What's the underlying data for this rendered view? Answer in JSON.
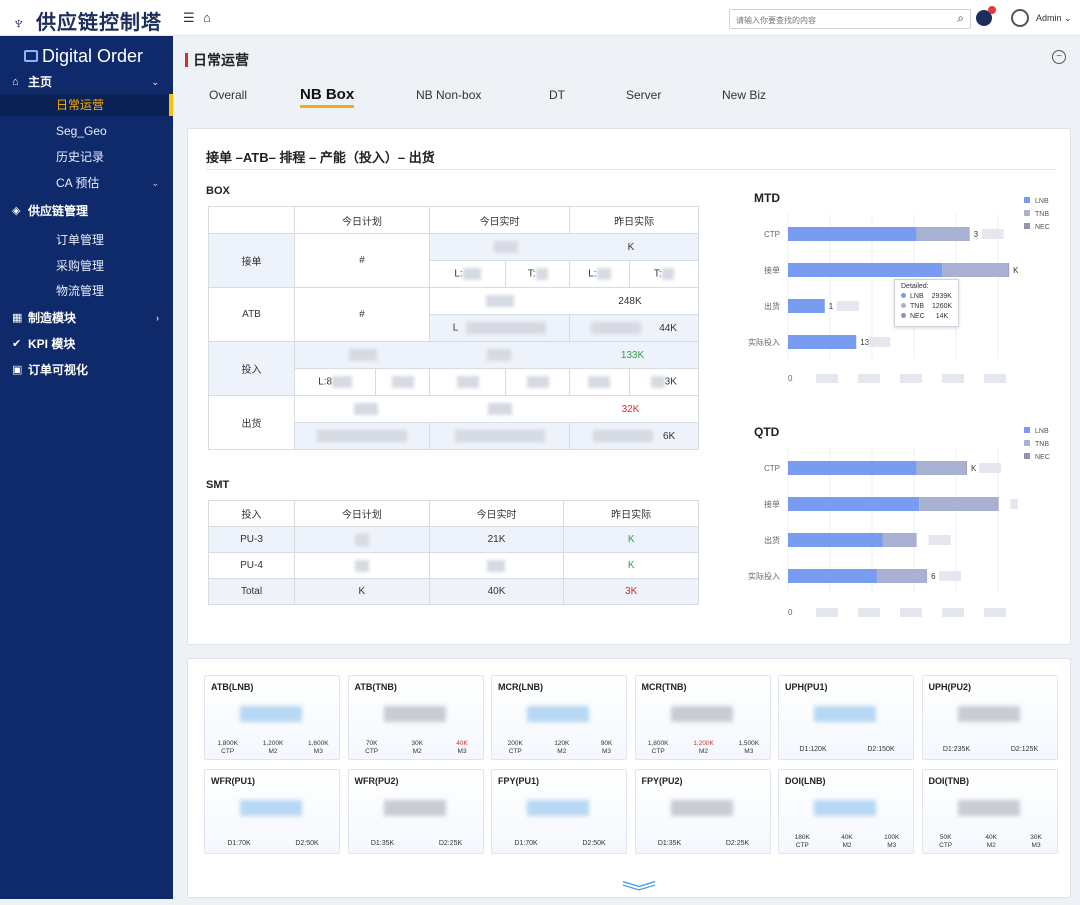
{
  "app": {
    "title": "供应链控制塔",
    "user": "Admin",
    "search_placeholder": "请输入你要查找的内容"
  },
  "sidebar": {
    "title": "Digital Order",
    "items": [
      {
        "label": "主页"
      },
      {
        "label": "日常运营"
      },
      {
        "label": "Seg_Geo"
      },
      {
        "label": "历史记录"
      },
      {
        "label": "CA 预估"
      },
      {
        "label": "供应链管理"
      },
      {
        "label": "订单管理"
      },
      {
        "label": "采购管理"
      },
      {
        "label": "物流管理"
      },
      {
        "label": "制造模块"
      },
      {
        "label": "KPI 模块"
      },
      {
        "label": "订单可视化"
      }
    ]
  },
  "page": {
    "title": "日常运营"
  },
  "tabs": [
    "Overall",
    "NB Box",
    "NB Non-box",
    "DT",
    "Server",
    "New Biz"
  ],
  "flow": {
    "title": "接单 –ATB– 排程 – 产能（投入）– 出货"
  },
  "box": {
    "label": "BOX",
    "headers": [
      "今日计划",
      "今日实时",
      "昨日实际"
    ],
    "rows": [
      {
        "name": "接单",
        "plan": "#",
        "y_total": "K",
        "l": "L:",
        "t": "T:",
        "yl": "L:",
        "yt": "T:"
      },
      {
        "name": "ATB",
        "plan": "#",
        "y_total": "248K",
        "l": "L",
        "y_sub": "44K"
      },
      {
        "name": "投入",
        "y_total": "133K",
        "l": "L:8",
        "y_sub": "3K"
      },
      {
        "name": "出货",
        "y_total": "32K",
        "y_sub": "6K"
      }
    ]
  },
  "smt": {
    "label": "SMT",
    "headers": [
      "投入",
      "今日计划",
      "今日实时",
      "昨日实际"
    ],
    "rows": [
      {
        "name": "PU-3",
        "plan": "",
        "real": "21K",
        "yest": "K"
      },
      {
        "name": "PU-4",
        "plan": "",
        "real": "",
        "yest": "K"
      },
      {
        "name": "Total",
        "plan": "K",
        "real": "40K",
        "yest": "3K"
      }
    ]
  },
  "colors": {
    "lnb": "#7a9cf0",
    "tnb": "#a9b1d3",
    "nec": "#9a8fb8"
  },
  "charts": {
    "legend": [
      "LNB",
      "TNB",
      "NEC"
    ],
    "tooltip": {
      "title": "Detailed:",
      "rows": [
        {
          "name": "LNB",
          "value": "2939K"
        },
        {
          "name": "TNB",
          "value": "1260K"
        },
        {
          "name": "NEC",
          "value": "14K"
        }
      ]
    }
  },
  "chart_data": [
    {
      "type": "bar",
      "title": "MTD",
      "categories": [
        "CTP",
        "接单",
        "出货",
        "实际投入"
      ],
      "series": [
        {
          "name": "LNB",
          "values": [
            2450,
            2939,
            700,
            1300
          ]
        },
        {
          "name": "TNB",
          "values": [
            1000,
            1260,
            0,
            0
          ]
        },
        {
          "name": "NEC",
          "values": [
            10,
            14,
            0,
            0
          ]
        }
      ],
      "data_labels": [
        "3",
        "K",
        "1",
        "13"
      ],
      "xtick_first": "0"
    },
    {
      "type": "bar",
      "title": "QTD",
      "categories": [
        "CTP",
        "接单",
        "出货",
        "实际投入"
      ],
      "series": [
        {
          "name": "LNB",
          "values": [
            2450,
            2500,
            1800,
            1700
          ]
        },
        {
          "name": "TNB",
          "values": [
            950,
            1500,
            650,
            950
          ]
        },
        {
          "name": "NEC",
          "values": [
            10,
            10,
            0,
            0
          ]
        }
      ],
      "data_labels": [
        "K",
        "",
        "",
        "6"
      ],
      "xtick_first": "0"
    }
  ],
  "kpis": [
    {
      "title": "ATB(LNB)",
      "subs": [
        [
          "1,800K",
          "CTP"
        ],
        [
          "1,200K",
          "M2"
        ],
        [
          "1,600K",
          "M3"
        ]
      ]
    },
    {
      "title": "ATB(TNB)",
      "subs": [
        [
          "70K",
          "CTP"
        ],
        [
          "30K",
          "M2"
        ],
        [
          "40K",
          "M3"
        ]
      ]
    },
    {
      "title": "MCR(LNB)",
      "subs": [
        [
          "200K",
          "CTP"
        ],
        [
          "120K",
          "M2"
        ],
        [
          "90K",
          "M3"
        ]
      ]
    },
    {
      "title": "MCR(TNB)",
      "subs": [
        [
          "1,800K",
          "CTP"
        ],
        [
          "1,200K",
          "M2"
        ],
        [
          "1,500K",
          "M3"
        ]
      ]
    },
    {
      "title": "UPH(PU1)",
      "d1": "D1:120K",
      "d2": "D2:150K"
    },
    {
      "title": "UPH(PU2)",
      "d1": "D1:235K",
      "d2": "D2:125K"
    },
    {
      "title": "WFR(PU1)",
      "d1": "D1:70K",
      "d2": "D2:50K"
    },
    {
      "title": "WFR(PU2)",
      "d1": "D1:35K",
      "d2": "D2:25K"
    },
    {
      "title": "FPY(PU1)",
      "d1": "D1:70K",
      "d2": "D2:50K"
    },
    {
      "title": "FPY(PU2)",
      "d1": "D1:35K",
      "d2": "D2:25K"
    },
    {
      "title": "DOI(LNB)",
      "subs": [
        [
          "180K",
          "CTP"
        ],
        [
          "40K",
          "M2"
        ],
        [
          "100K",
          "M3"
        ]
      ]
    },
    {
      "title": "DOI(TNB)",
      "subs": [
        [
          "50K",
          "CTP"
        ],
        [
          "40K",
          "M2"
        ],
        [
          "30K",
          "M3"
        ]
      ]
    }
  ]
}
